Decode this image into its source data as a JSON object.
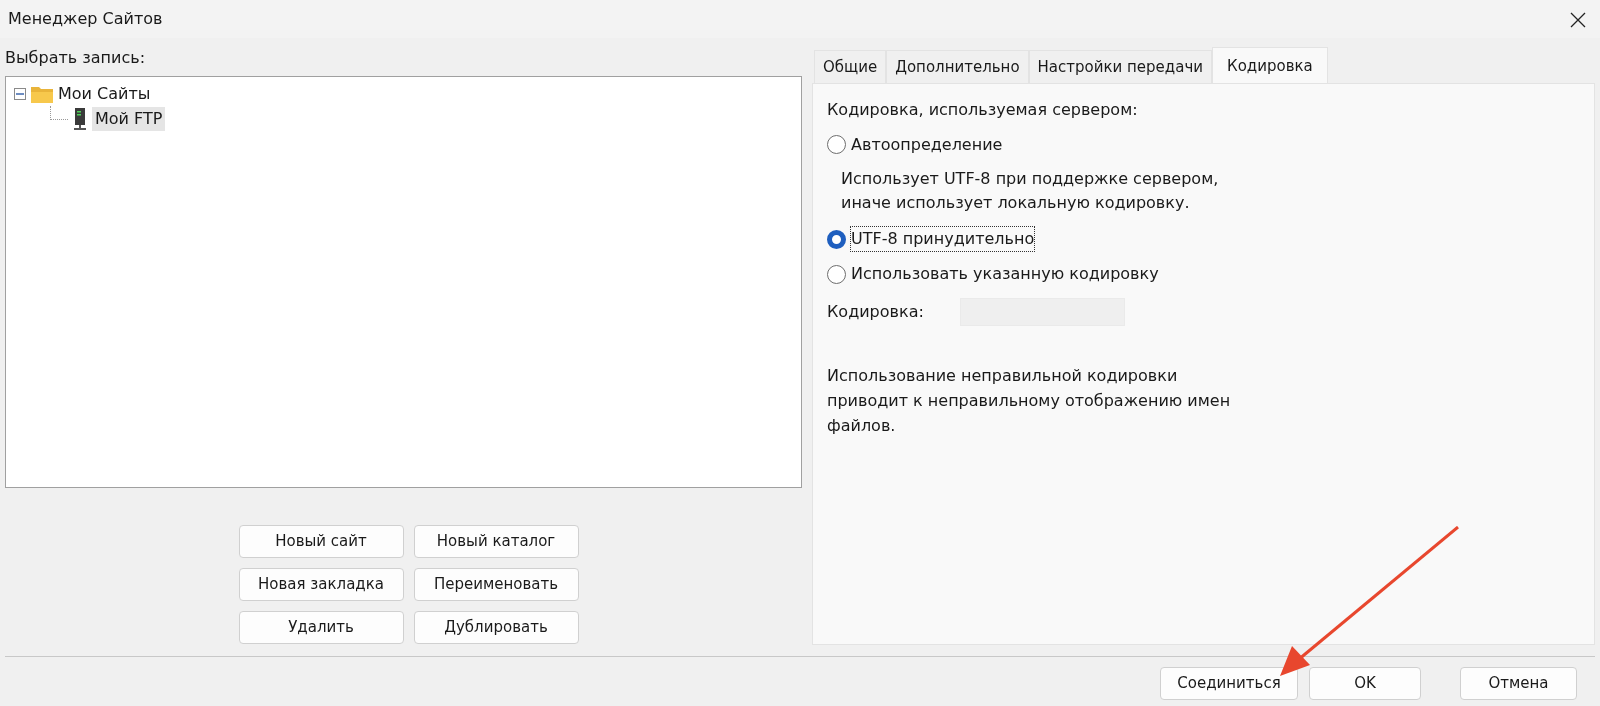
{
  "window": {
    "title": "Менеджер Сайтов"
  },
  "site_list": {
    "label": "Выбрать запись:",
    "tree": [
      {
        "label": "Мои Сайты",
        "kind": "folder",
        "expanded": true,
        "selected": false,
        "children": [
          {
            "label": "Мой FTP",
            "kind": "server",
            "selected": true
          }
        ]
      }
    ]
  },
  "site_buttons": [
    "Новый сайт",
    "Новый каталог",
    "Новая закладка",
    "Переименовать",
    "Удалить",
    "Дублировать"
  ],
  "tabs": [
    {
      "label": "Общие",
      "selected": false
    },
    {
      "label": "Дополнительно",
      "selected": false
    },
    {
      "label": "Настройки передачи",
      "selected": false
    },
    {
      "label": "Кодировка",
      "selected": true
    }
  ],
  "encoding": {
    "heading": "Кодировка, используемая сервером:",
    "options": [
      {
        "label": "Автоопределение",
        "selected": false,
        "focused": false,
        "note": "Использует UTF-8 при поддержке сервером, иначе использует локальную кодировку."
      },
      {
        "label": "UTF-8 принудительно",
        "selected": true,
        "focused": true
      },
      {
        "label": "Использовать указанную кодировку",
        "selected": false,
        "focused": false
      }
    ],
    "field": {
      "label": "Кодировка:",
      "disabled": true
    },
    "warning": "Использование неправильной кодировки приводит к неправильному отображению имен файлов."
  },
  "dialog_buttons": [
    "Соединиться",
    "OK",
    "Отмена"
  ]
}
